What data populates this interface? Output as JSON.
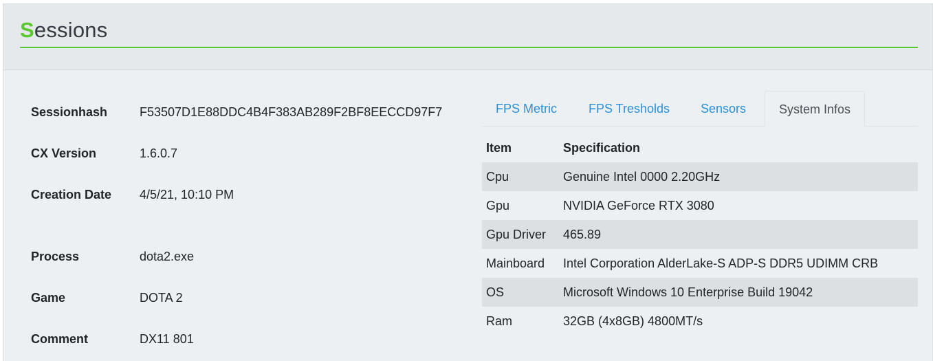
{
  "header": {
    "title_first": "S",
    "title_rest": "essions"
  },
  "session": {
    "rows": [
      {
        "label": "Sessionhash",
        "value": "F53507D1E88DDC4B4F383AB289F2BF8EECCD97F7"
      },
      {
        "label": "CX Version",
        "value": "1.6.0.7"
      },
      {
        "label": "Creation Date",
        "value": "4/5/21, 10:10 PM"
      },
      {
        "label": "Process",
        "value": "dota2.exe"
      },
      {
        "label": "Game",
        "value": "DOTA 2"
      },
      {
        "label": "Comment",
        "value": "DX11 801"
      }
    ]
  },
  "tabs": [
    {
      "label": "FPS Metric",
      "active": false
    },
    {
      "label": "FPS Tresholds",
      "active": false
    },
    {
      "label": "Sensors",
      "active": false
    },
    {
      "label": "System Infos",
      "active": true
    }
  ],
  "system_infos": {
    "headers": {
      "item": "Item",
      "spec": "Specification"
    },
    "rows": [
      {
        "item": "Cpu",
        "spec": "Genuine Intel 0000 2.20GHz"
      },
      {
        "item": "Gpu",
        "spec": "NVIDIA GeForce RTX 3080"
      },
      {
        "item": "Gpu Driver",
        "spec": "465.89"
      },
      {
        "item": "Mainboard",
        "spec": "Intel Corporation AlderLake-S ADP-S DDR5 UDIMM CRB"
      },
      {
        "item": "OS",
        "spec": "Microsoft Windows 10 Enterprise Build 19042"
      },
      {
        "item": "Ram",
        "spec": "32GB (4x8GB) 4800MT/s"
      }
    ]
  },
  "colors": {
    "accent_green": "#5ac92f",
    "link_blue": "#2a8fd6"
  }
}
